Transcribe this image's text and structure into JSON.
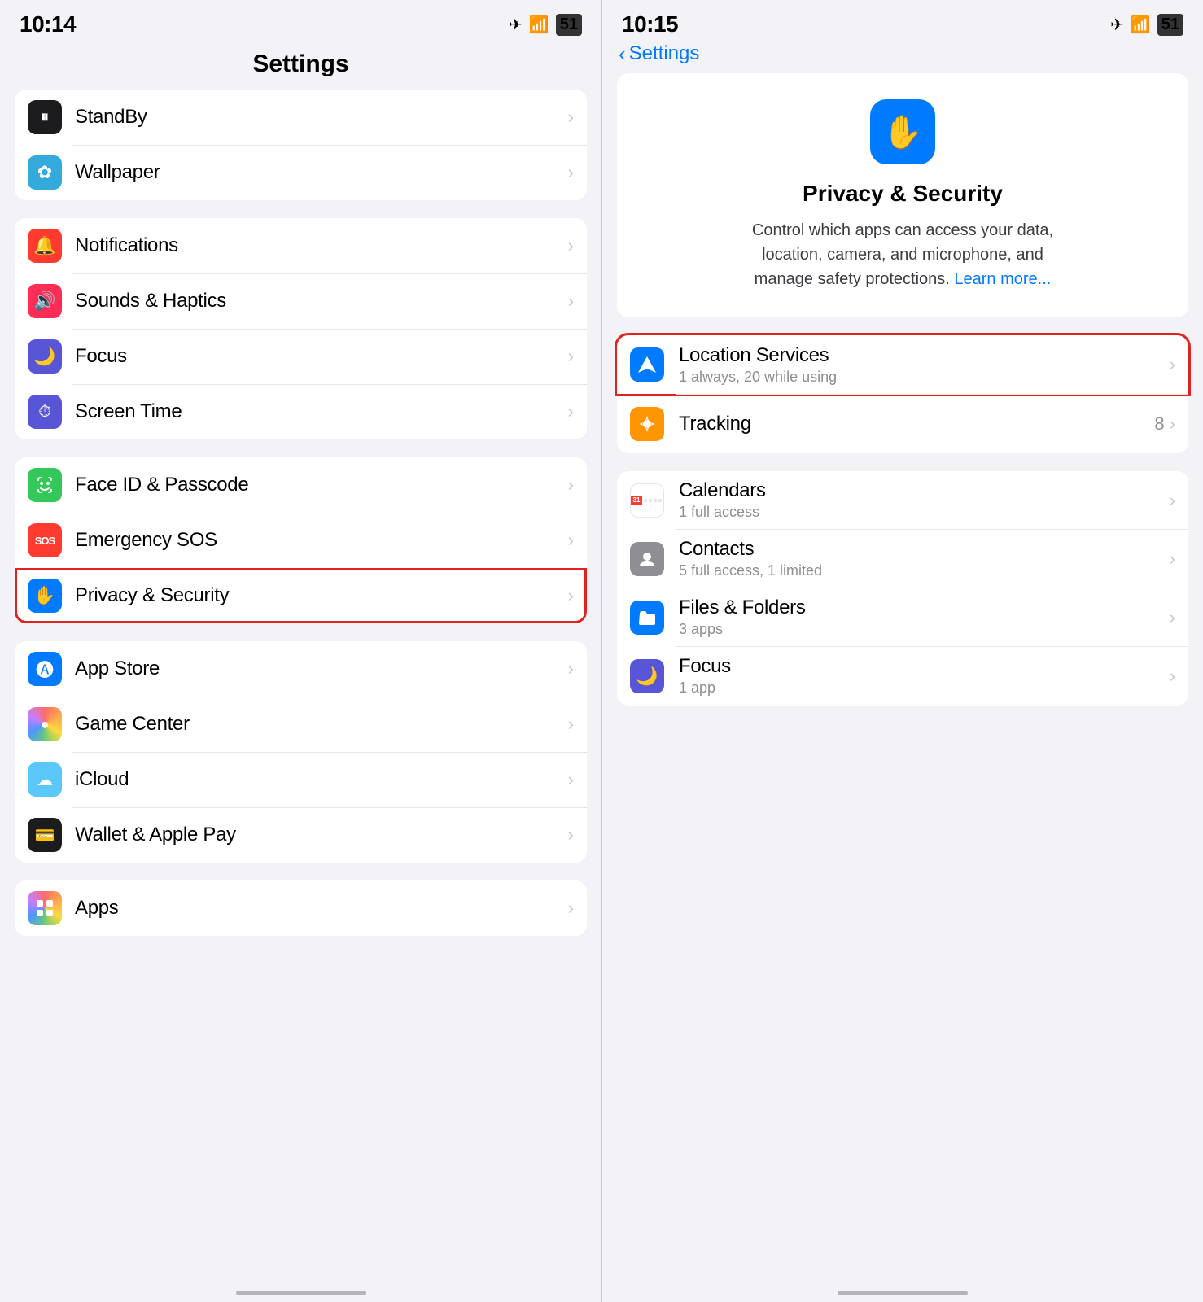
{
  "left": {
    "status": {
      "time": "10:14",
      "icons": "✈ ◀",
      "battery": "51"
    },
    "title": "Settings",
    "groups": [
      {
        "id": "group1",
        "rows": [
          {
            "id": "standby",
            "label": "StandBy",
            "iconBg": "icon-black",
            "iconSymbol": "⏸",
            "iconType": "standby"
          },
          {
            "id": "wallpaper",
            "label": "Wallpaper",
            "iconBg": "icon-blue-light",
            "iconSymbol": "✿",
            "iconType": "wallpaper"
          }
        ]
      },
      {
        "id": "group2",
        "rows": [
          {
            "id": "notifications",
            "label": "Notifications",
            "iconBg": "icon-red",
            "iconSymbol": "🔔",
            "iconType": "notifications"
          },
          {
            "id": "sounds",
            "label": "Sounds & Haptics",
            "iconBg": "icon-red-pink",
            "iconSymbol": "🔊",
            "iconType": "sounds"
          },
          {
            "id": "focus",
            "label": "Focus",
            "iconBg": "icon-purple",
            "iconSymbol": "🌙",
            "iconType": "focus"
          },
          {
            "id": "screentime",
            "label": "Screen Time",
            "iconBg": "icon-purple",
            "iconSymbol": "⏱",
            "iconType": "screentime"
          }
        ]
      },
      {
        "id": "group3",
        "rows": [
          {
            "id": "faceid",
            "label": "Face ID & Passcode",
            "iconBg": "icon-green",
            "iconSymbol": "😊",
            "iconType": "faceid"
          },
          {
            "id": "emergencysos",
            "label": "Emergency SOS",
            "iconBg": "icon-sos",
            "iconSymbol": "SOS",
            "iconType": "sos"
          },
          {
            "id": "privacy",
            "label": "Privacy & Security",
            "iconBg": "icon-blue",
            "iconSymbol": "✋",
            "iconType": "privacy",
            "highlighted": true
          }
        ]
      },
      {
        "id": "group4",
        "rows": [
          {
            "id": "appstore",
            "label": "App Store",
            "iconBg": "icon-blue",
            "iconSymbol": "A",
            "iconType": "appstore"
          },
          {
            "id": "gamecenter",
            "label": "Game Center",
            "iconBg": "icon-apps",
            "iconSymbol": "🎮",
            "iconType": "gamecenter"
          },
          {
            "id": "icloud",
            "label": "iCloud",
            "iconBg": "icon-teal",
            "iconSymbol": "☁",
            "iconType": "icloud"
          },
          {
            "id": "wallet",
            "label": "Wallet & Apple Pay",
            "iconBg": "icon-black",
            "iconSymbol": "💳",
            "iconType": "wallet"
          }
        ]
      },
      {
        "id": "group5",
        "rows": [
          {
            "id": "apps",
            "label": "Apps",
            "iconBg": "icon-apps",
            "iconSymbol": "⊞",
            "iconType": "apps"
          }
        ]
      }
    ]
  },
  "right": {
    "status": {
      "time": "10:15",
      "battery": "51"
    },
    "back_label": "Settings",
    "hero": {
      "title": "Privacy & Security",
      "desc": "Control which apps can access your data, location, camera, and microphone, and manage safety protections.",
      "learn_more": "Learn more..."
    },
    "location_row": {
      "title": "Location Services",
      "subtitle": "1 always, 20 while using",
      "iconBg": "icon-blue",
      "highlighted": true
    },
    "tracking_row": {
      "title": "Tracking",
      "badge": "8",
      "iconBg": "icon-orange"
    },
    "permission_rows": [
      {
        "id": "calendars",
        "title": "Calendars",
        "subtitle": "1 full access",
        "iconBg": "icon-red"
      },
      {
        "id": "contacts",
        "title": "Contacts",
        "subtitle": "5 full access, 1 limited",
        "iconBg": "#8e8e93"
      },
      {
        "id": "files",
        "title": "Files & Folders",
        "subtitle": "3 apps",
        "iconBg": "icon-blue"
      },
      {
        "id": "focusperm",
        "title": "Focus",
        "subtitle": "1 app",
        "iconBg": "icon-purple"
      }
    ]
  }
}
